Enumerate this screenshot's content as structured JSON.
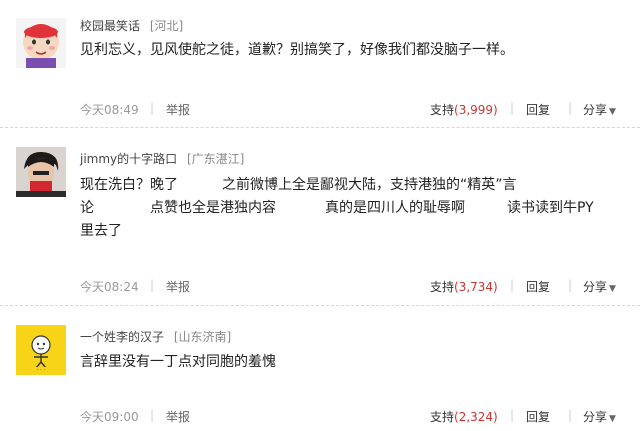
{
  "comments": [
    {
      "username": "校园最笑话",
      "location": "[河北]",
      "lines": [
        [
          "见利忘义，见风使舵之徒，道歉？别搞笑了，好像我们都没脑子一样。"
        ]
      ],
      "time": "今天08:49",
      "report": "举报",
      "support_label": "支持",
      "support_count": "(3,999)",
      "reply": "回复",
      "share": "分享",
      "share_icon": "caret-down-icon"
    },
    {
      "username": "jimmy的十字路口",
      "location": "[广东湛江]",
      "lines": [
        [
          "现在洗白？晚了",
          "之前微博上全是鄙视大陆，支持港独的“精英”言"
        ],
        [
          "论",
          "点赞也全是港独内容",
          "真的是四川人的耻辱啊",
          "读书读到牛PY"
        ],
        [
          "里去了"
        ]
      ],
      "time": "今天08:24",
      "report": "举报",
      "support_label": "支持",
      "support_count": "(3,734)",
      "reply": "回复",
      "share": "分享",
      "share_icon": "caret-down-icon"
    },
    {
      "username": "一个姓李的汉子",
      "location": "[山东济南]",
      "lines": [
        [
          "言辞里没有一丁点对同胞的羞愧"
        ]
      ],
      "time": "今天09:00",
      "report": "举报",
      "support_label": "支持",
      "support_count": "(2,324)",
      "reply": "回复",
      "share": "分享",
      "share_icon": "caret-down-icon"
    }
  ],
  "colors": {
    "support_count": "#cc3333",
    "meta_gray": "#999999",
    "divider": "#d6d6d6"
  }
}
